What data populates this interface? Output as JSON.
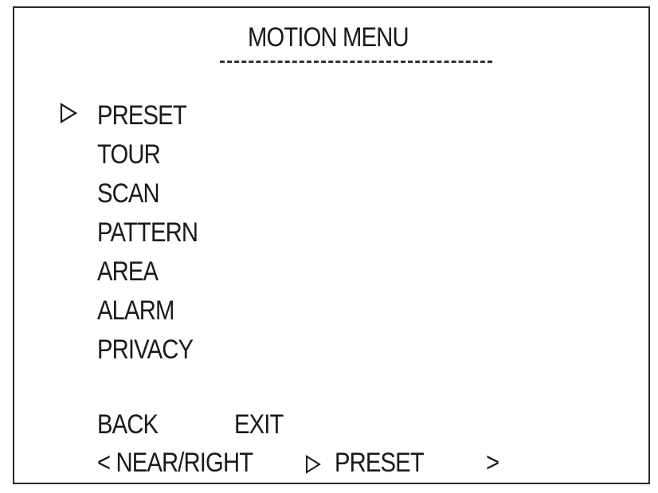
{
  "menu": {
    "title": "MOTION MENU",
    "cursor_icon": "outline-triangle-right-icon",
    "items": [
      {
        "label": "PRESET",
        "selected": true
      },
      {
        "label": "TOUR",
        "selected": false
      },
      {
        "label": "SCAN",
        "selected": false
      },
      {
        "label": "PATTERN",
        "selected": false
      },
      {
        "label": "AREA",
        "selected": false
      },
      {
        "label": "ALARM",
        "selected": false
      },
      {
        "label": "PRIVACY",
        "selected": false
      }
    ]
  },
  "actions": {
    "back_label": "BACK",
    "exit_label": "EXIT"
  },
  "status": {
    "left_label": "< NEAR/RIGHT",
    "current_label": "PRESET",
    "right_label": ">",
    "indicator_icon": "outline-triangle-right-icon"
  },
  "colors": {
    "background": "#ffffff",
    "text": "#1a1a1a",
    "border": "#2a2a2a"
  }
}
